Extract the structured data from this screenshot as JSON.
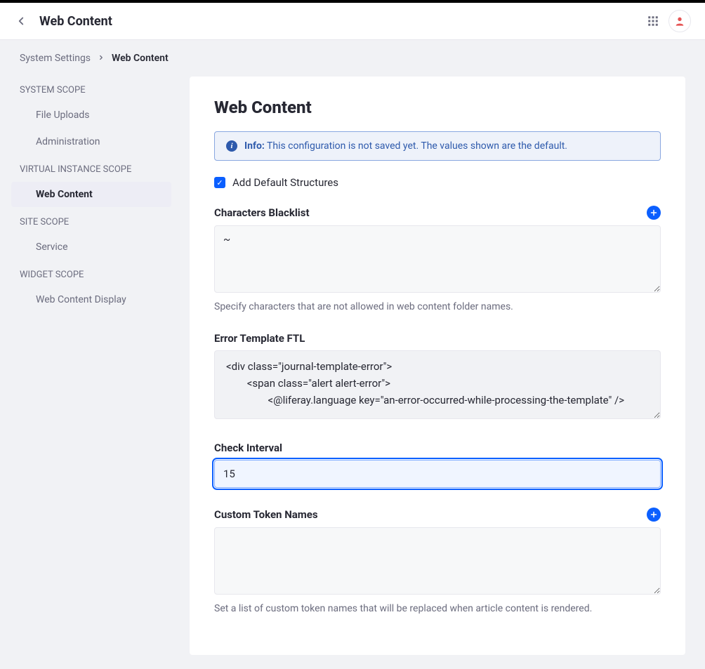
{
  "header": {
    "title": "Web Content"
  },
  "breadcrumb": {
    "parent": "System Settings",
    "current": "Web Content"
  },
  "sidebar": {
    "scopes": [
      {
        "header": "SYSTEM SCOPE",
        "items": [
          {
            "label": "File Uploads",
            "active": false
          },
          {
            "label": "Administration",
            "active": false
          }
        ]
      },
      {
        "header": "VIRTUAL INSTANCE SCOPE",
        "items": [
          {
            "label": "Web Content",
            "active": true
          }
        ]
      },
      {
        "header": "SITE SCOPE",
        "items": [
          {
            "label": "Service",
            "active": false
          }
        ]
      },
      {
        "header": "WIDGET SCOPE",
        "items": [
          {
            "label": "Web Content Display",
            "active": false
          }
        ]
      }
    ]
  },
  "panel": {
    "title": "Web Content",
    "info": {
      "label": "Info:",
      "text": "This configuration is not saved yet. The values shown are the default."
    },
    "addDefaultStructures": {
      "label": "Add Default Structures",
      "checked": true
    },
    "charactersBlacklist": {
      "label": "Characters Blacklist",
      "value": "~",
      "help": "Specify characters that are not allowed in web content folder names."
    },
    "errorTemplateFtl": {
      "label": "Error Template FTL",
      "value": "<div class=\"journal-template-error\">\n        <span class=\"alert alert-error\">\n                <@liferay.language key=\"an-error-occurred-while-processing-the-template\" />"
    },
    "checkInterval": {
      "label": "Check Interval",
      "value": "15"
    },
    "customTokenNames": {
      "label": "Custom Token Names",
      "value": "",
      "help": "Set a list of custom token names that will be replaced when article content is rendered."
    }
  }
}
